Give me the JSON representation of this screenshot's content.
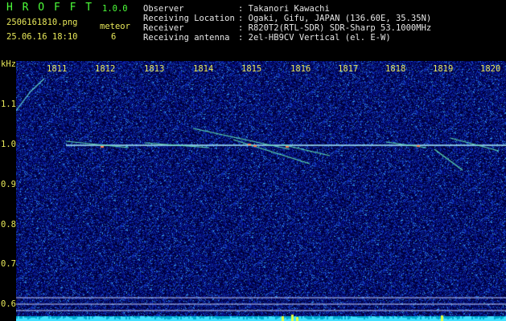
{
  "header": {
    "title": "H R O F F T",
    "version": "1.0.0",
    "filename": "2506161810.png",
    "datetime": "25.06.16 18:10",
    "meteor_label": "meteor",
    "meteor_count": "6",
    "info": [
      {
        "key": "Observer",
        "value": ": Takanori Kawachi"
      },
      {
        "key": "Receiving Location",
        "value": ": Ogaki, Gifu, JAPAN (136.60E, 35.35N)"
      },
      {
        "key": "Receiver",
        "value": ": R820T2(RTL-SDR) SDR-Sharp 53.1000MHz"
      },
      {
        "key": "Receiving antenna",
        "value": ": 2el-HB9CV Vertical (el. E-W)"
      }
    ]
  },
  "axis": {
    "y_unit": "kHz",
    "x_ticks": [
      "1811",
      "1812",
      "1813",
      "1814",
      "1815",
      "1816",
      "1817",
      "1818",
      "1819",
      "1820"
    ],
    "y_ticks": [
      "1.1",
      "1.0",
      "0.9",
      "0.8",
      "0.7",
      "0.6"
    ]
  },
  "colors": {
    "title": "#4dff3a",
    "labels": "#e8e85a",
    "info_text": "#e6e6e6",
    "background": "#000000",
    "noise": "#1a2a8a",
    "carrier": "#9ff0ff"
  }
}
